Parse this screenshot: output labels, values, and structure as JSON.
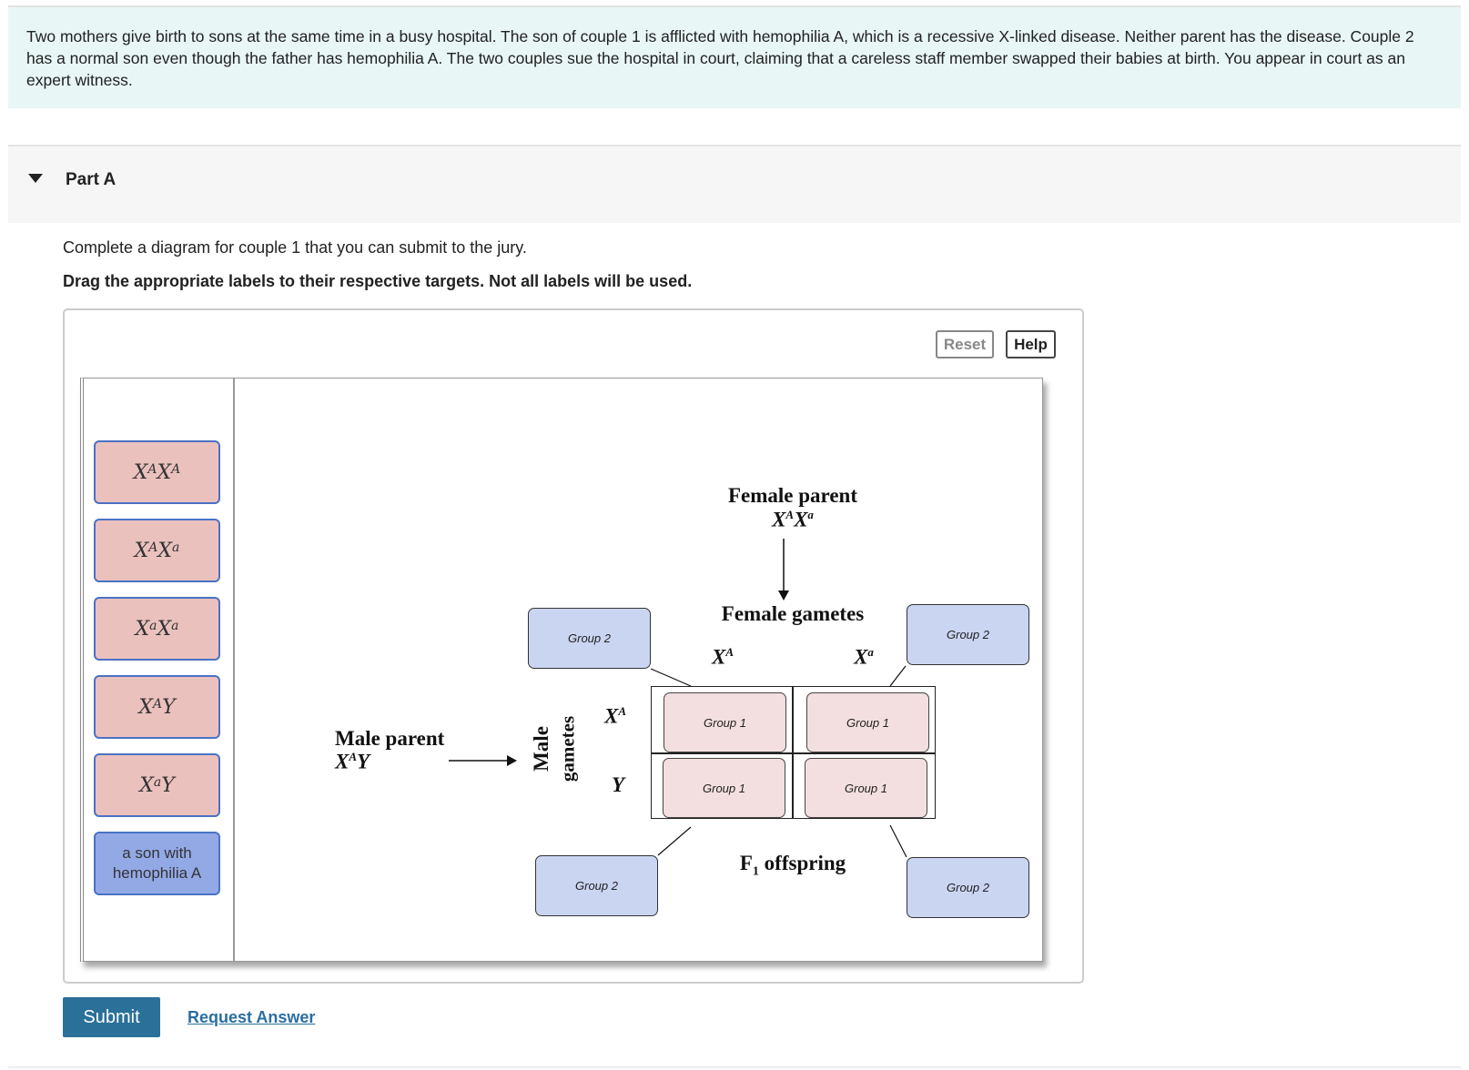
{
  "intro": "Two mothers give birth to sons at the same time in a busy hospital. The son of couple 1 is afflicted with hemophilia A, which is a recessive X-linked disease. Neither parent has the disease. Couple 2 has a normal son even though the father has hemophilia A. The two couples sue the hospital in court, claiming that a careless staff member swapped their babies at birth. You appear in court as an expert witness.",
  "part": {
    "title": "Part A",
    "question": "Complete a diagram for couple 1 that you can submit to the jury.",
    "instruction": "Drag the appropriate labels to their respective targets. Not all labels will be used."
  },
  "toolbar": {
    "reset": "Reset",
    "help": "Help"
  },
  "labels": [
    {
      "b1": "X",
      "s1": "A",
      "b2": "X",
      "s2": "A"
    },
    {
      "b1": "X",
      "s1": "A",
      "b2": "X",
      "s2": "a"
    },
    {
      "b1": "X",
      "s1": "a",
      "b2": "X",
      "s2": "a"
    },
    {
      "b1": "X",
      "s1": "A",
      "b2": "Y",
      "s2": ""
    },
    {
      "b1": "X",
      "s1": "a",
      "b2": "Y",
      "s2": ""
    }
  ],
  "text_label": "a son with hemophilia A",
  "diagram": {
    "female_parent": "Female parent",
    "female_genotype": {
      "b1": "X",
      "s1": "A",
      "b2": "X",
      "s2": "a"
    },
    "female_gametes": "Female gametes",
    "fg1": {
      "b": "X",
      "s": "A"
    },
    "fg2": {
      "b": "X",
      "s": "a"
    },
    "male_parent": "Male parent",
    "male_genotype": {
      "b1": "X",
      "s1": "A",
      "b2": "Y"
    },
    "male_gametes_1": "Male",
    "male_gametes_2": "gametes",
    "mg1": {
      "b": "X",
      "s": "A"
    },
    "mg2": "Y",
    "f1": "F",
    "f1_sub": "1",
    "f1_rest": " offspring",
    "group1": "Group 1",
    "group2": "Group 2"
  },
  "colors": {
    "label_pink": "#ebc1be",
    "label_blue": "#93a9e6",
    "group1": "#f3dfdf",
    "group2": "#cad5f2",
    "submit": "#2a7099"
  },
  "actions": {
    "submit": "Submit",
    "request_answer": "Request Answer"
  }
}
